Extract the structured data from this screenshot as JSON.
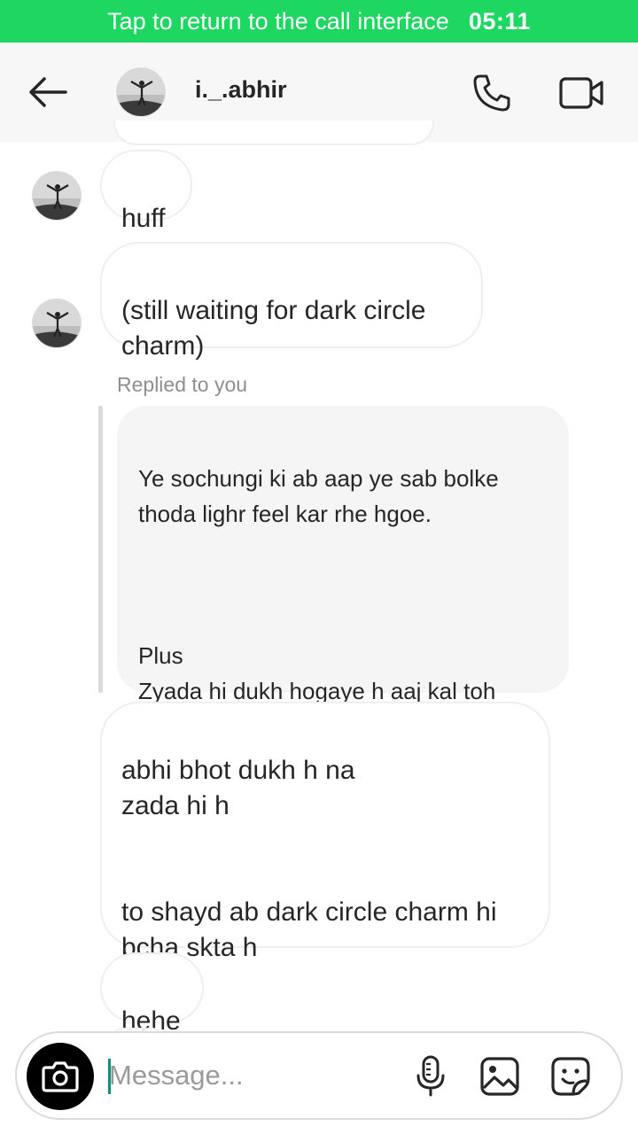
{
  "call_banner": {
    "text": "Tap to return to the call interface",
    "time": "05:11",
    "color": "#1ed760"
  },
  "header": {
    "username": "i._.abhir",
    "icons": [
      "back-arrow-icon",
      "phone-icon",
      "video-camera-icon"
    ]
  },
  "messages": [
    {
      "text": "huff"
    },
    {
      "text": "(still waiting for dark circle\ncharm)"
    },
    {
      "text": "abhi bhot dukh h na\nzada hi h\n\n\nto shayd ab dark circle charm hi\nbcha skta h"
    },
    {
      "text": "hehe"
    }
  ],
  "reply": {
    "label": "Replied to you",
    "quoted_text": "Ye sochungi ki ab aap ye sab bolke\nthoda lighr feel kar rhe hgoe.\n\n\n\nPlus\nZyada hi dukh hogaye h aaj kal toh"
  },
  "composer": {
    "placeholder": "Message...",
    "icons": [
      "camera-icon",
      "microphone-icon",
      "gallery-icon",
      "sticker-icon"
    ]
  }
}
